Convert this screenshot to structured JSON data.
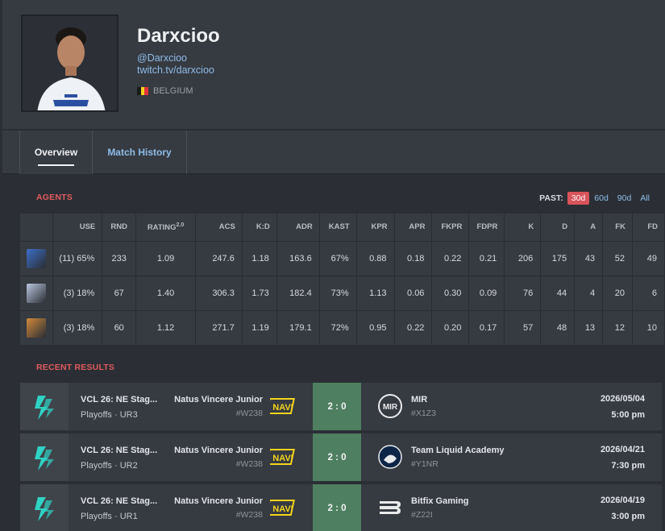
{
  "profile": {
    "name": "Darxcioo",
    "handle": "@Darxcioo",
    "twitch": "twitch.tv/darxcioo",
    "country": "BELGIUM"
  },
  "tabs": [
    {
      "label": "Overview",
      "active": true
    },
    {
      "label": "Match History",
      "active": false
    }
  ],
  "agents_section": {
    "title": "AGENTS",
    "past_label": "PAST:",
    "periods": [
      "30d",
      "60d",
      "90d",
      "All"
    ],
    "selected_period": "30d",
    "columns": [
      "USE",
      "RND",
      "RATING",
      "ACS",
      "K:D",
      "ADR",
      "KAST",
      "KPR",
      "APR",
      "FKPR",
      "FDPR",
      "K",
      "D",
      "A",
      "FK",
      "FD"
    ],
    "rating_sup": "2.0",
    "rows": [
      {
        "icon": "agent-1-icon",
        "color": "#3d6fc7",
        "cells": [
          "(11) 65%",
          "233",
          "1.09",
          "247.6",
          "1.18",
          "163.6",
          "67%",
          "0.88",
          "0.18",
          "0.22",
          "0.21",
          "206",
          "175",
          "43",
          "52",
          "49"
        ]
      },
      {
        "icon": "agent-2-icon",
        "color": "#b9c6de",
        "cells": [
          "(3) 18%",
          "67",
          "1.40",
          "306.3",
          "1.73",
          "182.4",
          "73%",
          "1.13",
          "0.06",
          "0.30",
          "0.09",
          "76",
          "44",
          "4",
          "20",
          "6"
        ]
      },
      {
        "icon": "agent-3-icon",
        "color": "#d08a3c",
        "cells": [
          "(3) 18%",
          "60",
          "1.12",
          "271.7",
          "1.19",
          "179.1",
          "72%",
          "0.95",
          "0.22",
          "0.20",
          "0.17",
          "57",
          "48",
          "13",
          "12",
          "10"
        ]
      }
    ]
  },
  "recent_results": {
    "title": "RECENT RESULTS",
    "matches": [
      {
        "event": "VCL 26: NE Stag...",
        "stage": "Playoffs · UR3",
        "team_a": "Natus Vincere Junior",
        "tag_a": "#W238",
        "score": "2 : 0",
        "team_b": "MIR",
        "tag_b": "#X1Z3",
        "team_b_logo": "mir-logo",
        "date": "2026/05/04",
        "time": "5:00 pm"
      },
      {
        "event": "VCL 26: NE Stag...",
        "stage": "Playoffs · UR2",
        "team_a": "Natus Vincere Junior",
        "tag_a": "#W238",
        "score": "2 : 0",
        "team_b": "Team Liquid Academy",
        "tag_b": "#Y1NR",
        "team_b_logo": "liquid-logo",
        "date": "2026/04/21",
        "time": "7:30 pm"
      },
      {
        "event": "VCL 26: NE Stag...",
        "stage": "Playoffs · UR1",
        "team_a": "Natus Vincere Junior",
        "tag_a": "#W238",
        "score": "2 : 0",
        "team_b": "Bitfix Gaming",
        "tag_b": "#Z22I",
        "team_b_logo": "bitfix-logo",
        "date": "2026/04/19",
        "time": "3:00 pm"
      }
    ]
  },
  "colors": {
    "accent_red": "#e05a5e",
    "link_blue": "#8fbde8",
    "win_green": "#4e7f60",
    "event_logo_cyan": "#2fd3c4",
    "navi_yellow": "#f3d51c"
  }
}
